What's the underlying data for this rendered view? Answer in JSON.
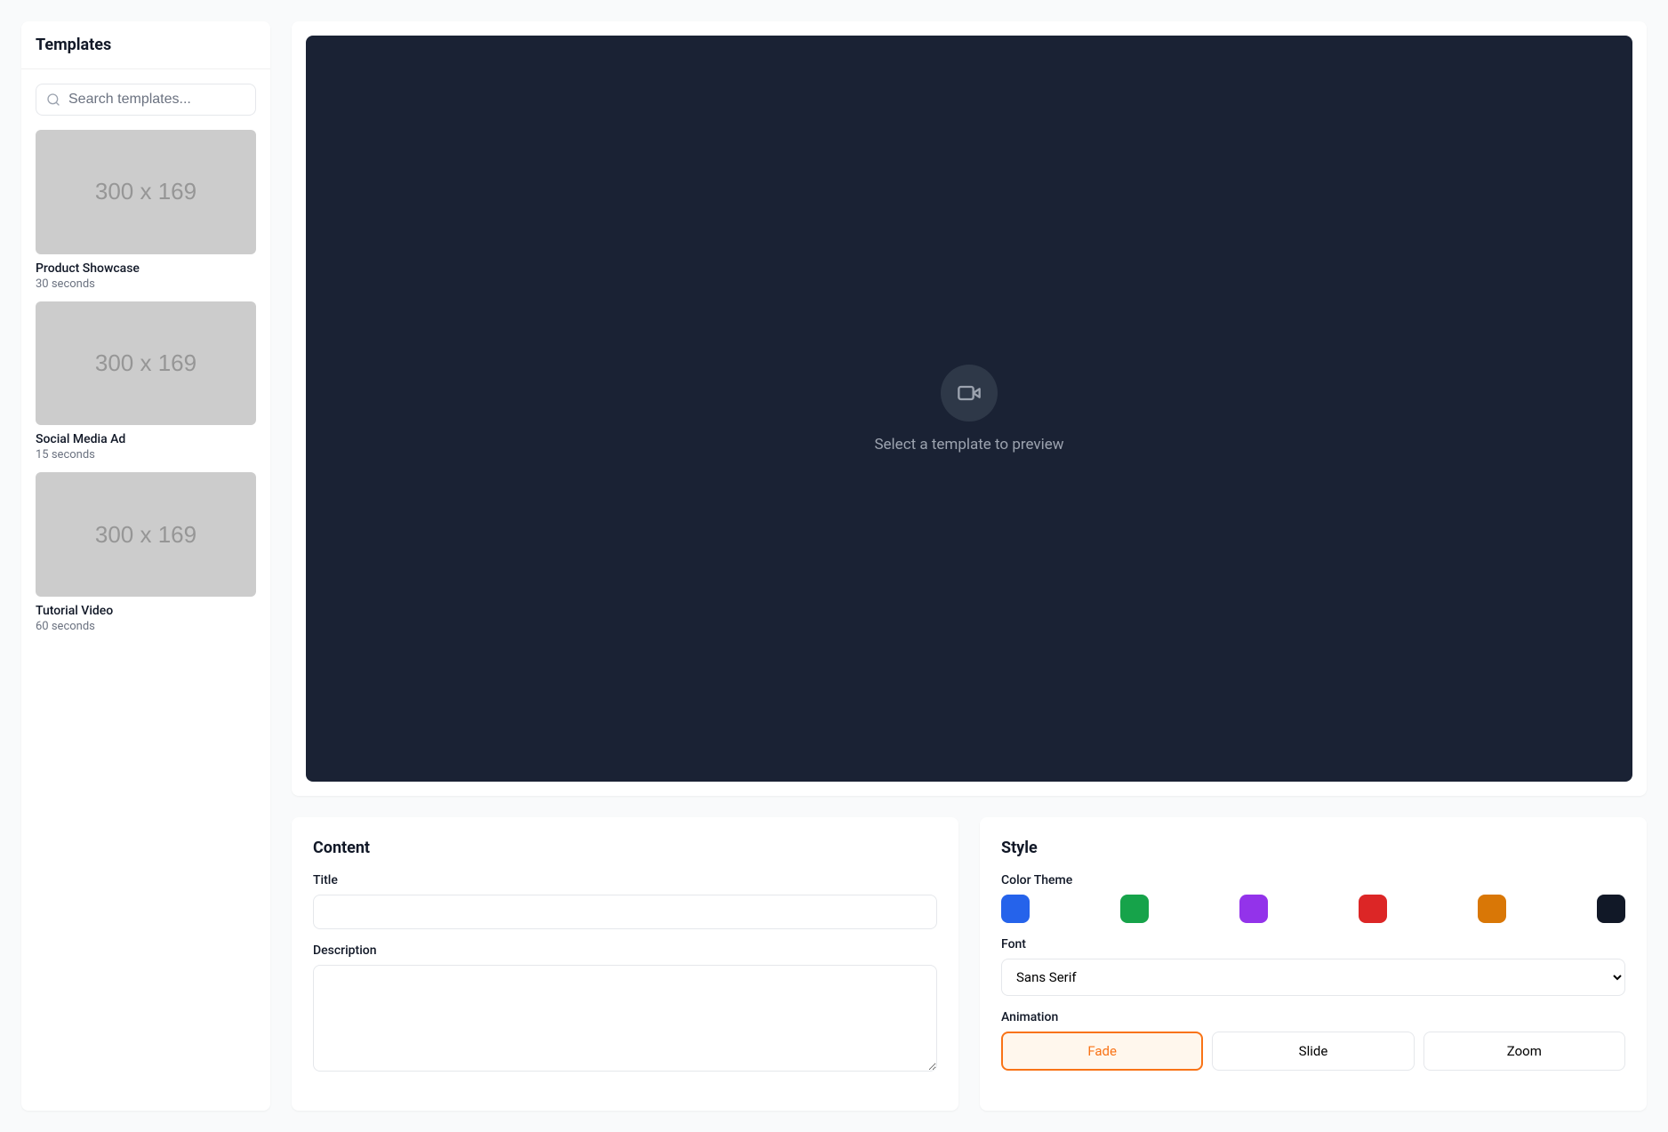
{
  "sidebar": {
    "title": "Templates",
    "search_placeholder": "Search templates...",
    "thumb_text": "300 x 169",
    "templates": [
      {
        "name": "Product Showcase",
        "duration": "30 seconds"
      },
      {
        "name": "Social Media Ad",
        "duration": "15 seconds"
      },
      {
        "name": "Tutorial Video",
        "duration": "60 seconds"
      }
    ]
  },
  "preview": {
    "empty_message": "Select a template to preview"
  },
  "content_panel": {
    "heading": "Content",
    "title_label": "Title",
    "title_value": "",
    "description_label": "Description",
    "description_value": ""
  },
  "style_panel": {
    "heading": "Style",
    "color_theme_label": "Color Theme",
    "colors": [
      {
        "name": "blue",
        "hex": "#2563eb"
      },
      {
        "name": "green",
        "hex": "#16a34a"
      },
      {
        "name": "purple",
        "hex": "#9333ea"
      },
      {
        "name": "red",
        "hex": "#dc2626"
      },
      {
        "name": "amber",
        "hex": "#d97706"
      },
      {
        "name": "navy",
        "hex": "#111827"
      }
    ],
    "font_label": "Font",
    "font_selected": "Sans Serif",
    "animation_label": "Animation",
    "animations": [
      {
        "label": "Fade",
        "active": true
      },
      {
        "label": "Slide",
        "active": false
      },
      {
        "label": "Zoom",
        "active": false
      }
    ]
  }
}
